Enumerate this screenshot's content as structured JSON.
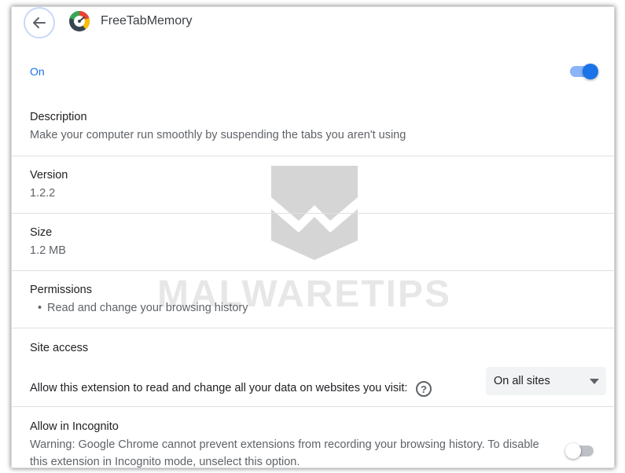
{
  "header": {
    "back_icon": "arrow-left-icon",
    "extension_icon": "speedometer-icon",
    "extension_name": "FreeTabMemory"
  },
  "enabled": {
    "label": "On",
    "state": true,
    "accent_color": "#1a73e8"
  },
  "description": {
    "title": "Description",
    "value": "Make your computer run smoothly by suspending the tabs you aren't using"
  },
  "version": {
    "title": "Version",
    "value": "1.2.2"
  },
  "size": {
    "title": "Size",
    "value": "1.2 MB"
  },
  "permissions": {
    "title": "Permissions",
    "items": [
      "Read and change your browsing history"
    ]
  },
  "site_access": {
    "title": "Site access",
    "prompt": "Allow this extension to read and change all your data on websites you visit:",
    "help_icon": "question-circle-icon",
    "selected": "On all sites"
  },
  "incognito": {
    "title": "Allow in Incognito",
    "warning_line1": "Warning: Google Chrome cannot prevent extensions from recording your browsing history. To disable",
    "warning_line2": "this extension in Incognito mode, unselect this option.",
    "state": false
  },
  "watermark": {
    "text": "MALWARETIPS"
  }
}
